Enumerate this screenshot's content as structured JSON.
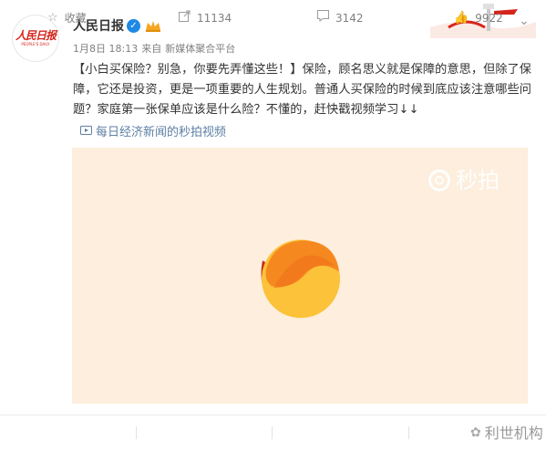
{
  "account": {
    "name": "人民日报",
    "avatar_text": "人民日报",
    "avatar_subtext": "PEOPLE'S DAILY",
    "verified_icon": "verified-badge-icon",
    "vip_icon": "vip-crown-icon"
  },
  "meta": {
    "date": "1月8日 18:13",
    "source_prefix": "来自",
    "source": "新媒体聚合平台"
  },
  "post": {
    "headline": "【小白买保险？别急，你要先弄懂这些！】",
    "body": "保险，顾名思义就是保障的意思，但除了保障，它还是投资，更是一项重要的人生规划。普通人买保险的时候到底应该注意哪些问题？家庭第一张保单应该是什么险？不懂的，赶快戳视频学习↓↓"
  },
  "video_link": {
    "label": "每日经济新闻的秒拍视频",
    "icon": "video-icon"
  },
  "video": {
    "watermark": "秒拍",
    "background": "#fdeedd",
    "loader_colors": [
      "#f5891f",
      "#fbc23a",
      "#d6251c"
    ]
  },
  "actions": {
    "favorite": "收藏",
    "repost_count": "11134",
    "comment_count": "3142",
    "like_count": "9922"
  },
  "overlay_watermark": "利世机构",
  "colors": {
    "accent_link": "#5d7fa3",
    "brand_red": "#d6251c",
    "verified_blue": "#1e88e5"
  }
}
